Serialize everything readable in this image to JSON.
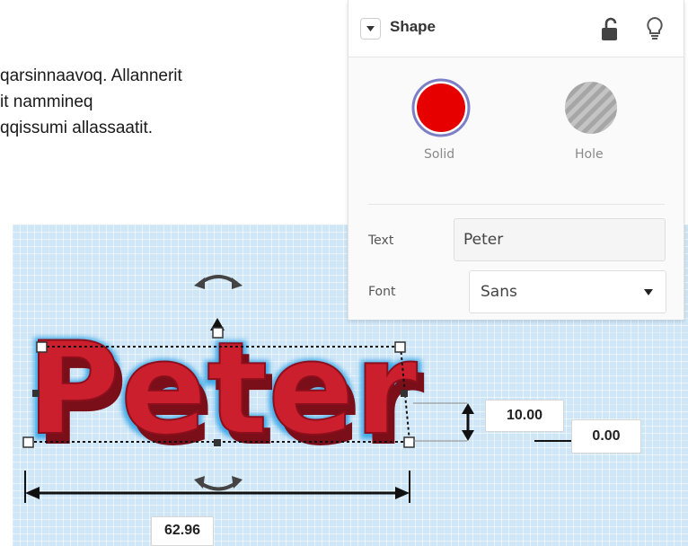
{
  "document": {
    "lines": [
      "qarsinnaavoq. Allannerit",
      "it nammineq",
      "qqissumi allassaatit."
    ]
  },
  "panel": {
    "title": "Shape",
    "lock_icon": "unlock-icon",
    "bulb_icon": "lightbulb-icon",
    "solid_label": "Solid",
    "hole_label": "Hole",
    "text_label": "Text",
    "text_value": "Peter",
    "font_label": "Font",
    "font_value": "Sans"
  },
  "scene": {
    "text_object": "Peter",
    "dimensions": {
      "height": "10.00",
      "elevation": "0.00",
      "width": "62.96"
    }
  },
  "colors": {
    "solid": "#e60000",
    "solid_ring": "#7c7fc6",
    "hole": "#a6a6a6",
    "workplane": "#cfe6f7",
    "text_fill": "#cc1f2e",
    "text_glow": "#3ea9e8"
  }
}
